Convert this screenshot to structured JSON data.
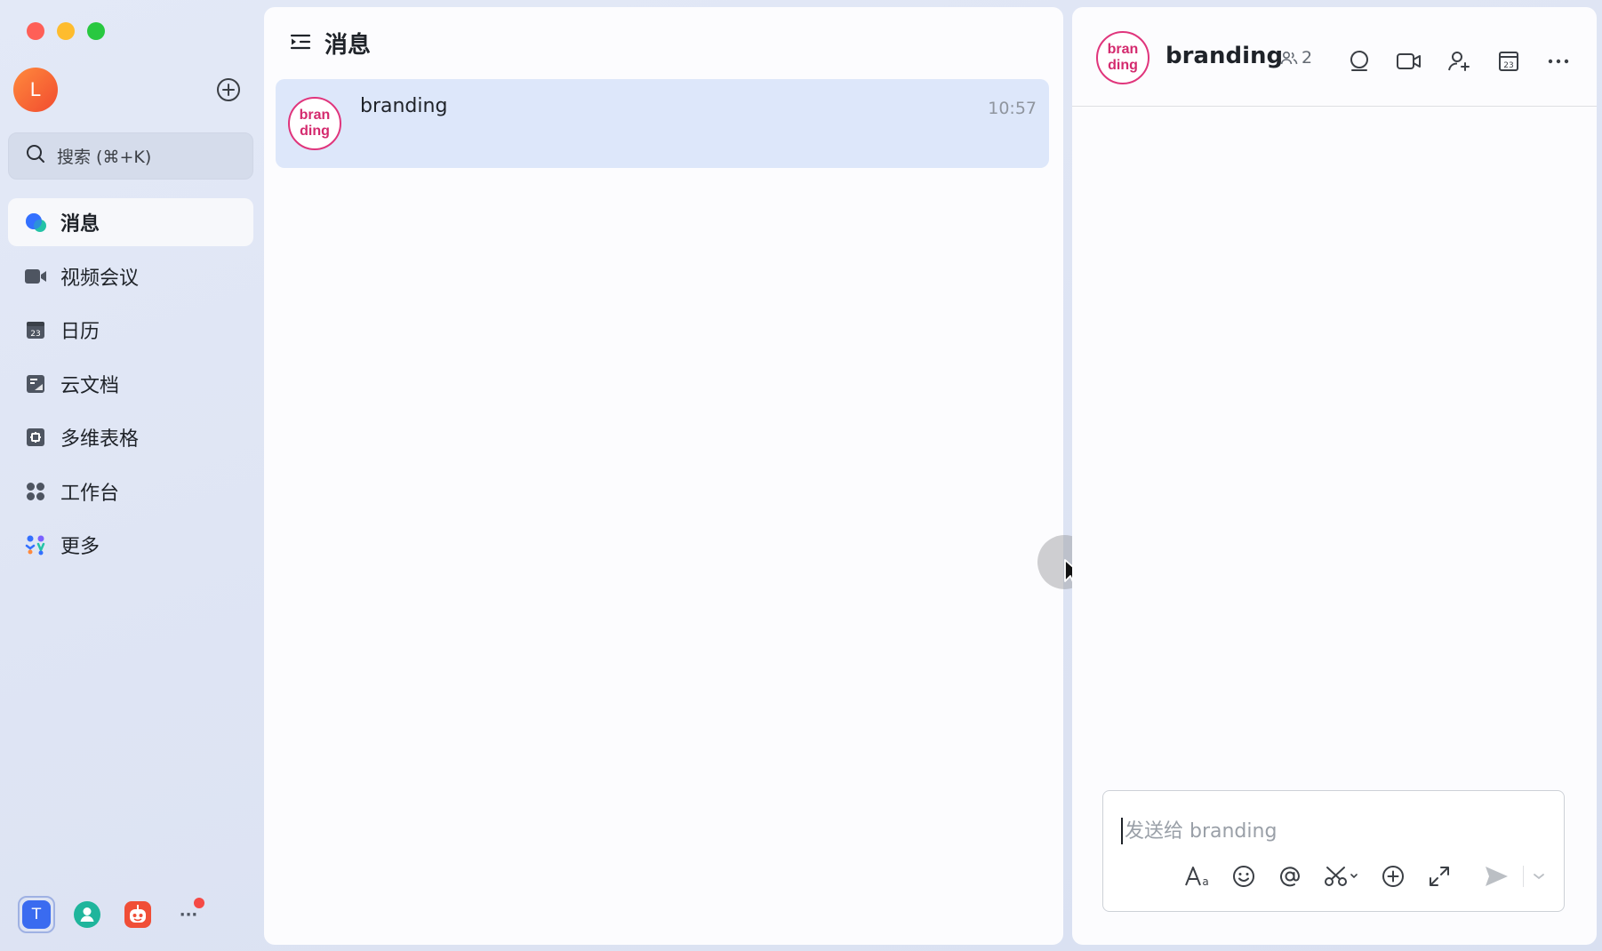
{
  "sidebar": {
    "user_initial": "L",
    "search_placeholder": "搜索 (⌘+K)",
    "items": [
      {
        "label": "消息",
        "icon": "message-bubble-icon"
      },
      {
        "label": "视频会议",
        "icon": "video-camera-icon"
      },
      {
        "label": "日历",
        "icon": "calendar-icon"
      },
      {
        "label": "云文档",
        "icon": "cloud-doc-icon"
      },
      {
        "label": "多维表格",
        "icon": "base-table-icon"
      },
      {
        "label": "工作台",
        "icon": "workplace-grid-icon"
      },
      {
        "label": "更多",
        "icon": "more-apps-icon"
      }
    ],
    "active_index": 0,
    "dock": [
      {
        "label": "T",
        "icon": "app-t-icon"
      },
      {
        "label": "",
        "icon": "contact-icon"
      },
      {
        "label": "",
        "icon": "robot-icon"
      },
      {
        "label": "···",
        "icon": "more-dots-icon"
      }
    ]
  },
  "message_list": {
    "title": "消息",
    "chats": [
      {
        "name": "branding",
        "time": "10:57",
        "avatar_line1": "bran",
        "avatar_line2": "ding"
      }
    ]
  },
  "chat": {
    "title": "branding",
    "member_count": "2",
    "avatar_line1": "bran",
    "avatar_line2": "ding",
    "composer_placeholder": "发送给 branding"
  },
  "colors": {
    "accent": "#3a6bf0",
    "selected_row": "#dde7fa",
    "group_avatar": "#e0357c"
  }
}
